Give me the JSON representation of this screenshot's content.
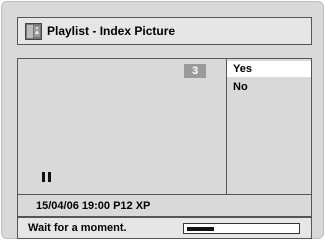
{
  "title": {
    "text": "Playlist - Index Picture",
    "icon": "index-picture-icon"
  },
  "video": {
    "index_number": "3",
    "playback_state": "paused"
  },
  "menu": {
    "items": [
      {
        "label": "Yes",
        "selected": true
      },
      {
        "label": "No",
        "selected": false
      }
    ]
  },
  "info": {
    "text": "15/04/06  19:00  P12  XP"
  },
  "status": {
    "message": "Wait for a moment.",
    "progress": 0.25
  }
}
